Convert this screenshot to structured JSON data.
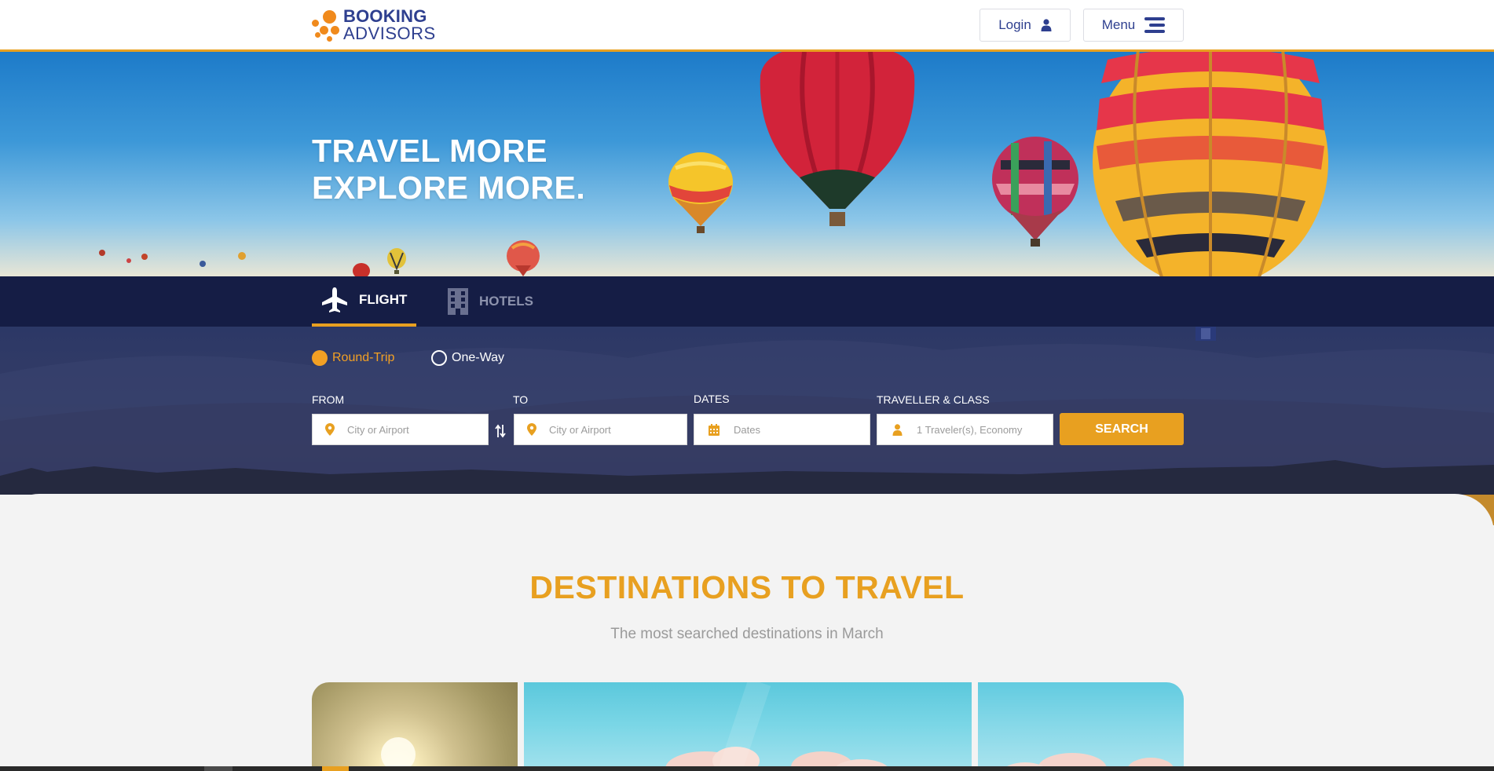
{
  "header": {
    "logo_line1": "BOOKING",
    "logo_line2": "ADVISORS",
    "login_label": "Login",
    "menu_label": "Menu"
  },
  "hero": {
    "title_line1": "TRAVEL MORE",
    "title_line2": "EXPLORE MORE."
  },
  "tabs": [
    {
      "label": "FLIGHT",
      "icon": "plane-icon",
      "active": true
    },
    {
      "label": "HOTELS",
      "icon": "building-icon",
      "active": false
    }
  ],
  "search": {
    "trip_types": [
      {
        "label": "Round-Trip",
        "selected": true
      },
      {
        "label": "One-Way",
        "selected": false
      }
    ],
    "from": {
      "label": "FROM",
      "placeholder": "City or Airport",
      "icon": "map-pin-icon"
    },
    "to": {
      "label": "TO",
      "placeholder": "City or Airport",
      "icon": "map-pin-icon"
    },
    "dates": {
      "label": "DATES",
      "placeholder": "Dates",
      "icon": "calendar-icon"
    },
    "traveller": {
      "label": "TRAVELLER & CLASS",
      "placeholder": "1 Traveler(s), Economy",
      "icon": "user-icon"
    },
    "swap_icon": "swap-arrows-icon",
    "search_label": "SEARCH"
  },
  "destinations": {
    "title": "DESTINATIONS TO TRAVEL",
    "subtitle": "The most searched destinations in March"
  },
  "colors": {
    "brand_blue": "#2e3f8f",
    "accent_orange": "#e8a020",
    "navy": "#151d45",
    "logo_orange": "#f08a1c"
  }
}
